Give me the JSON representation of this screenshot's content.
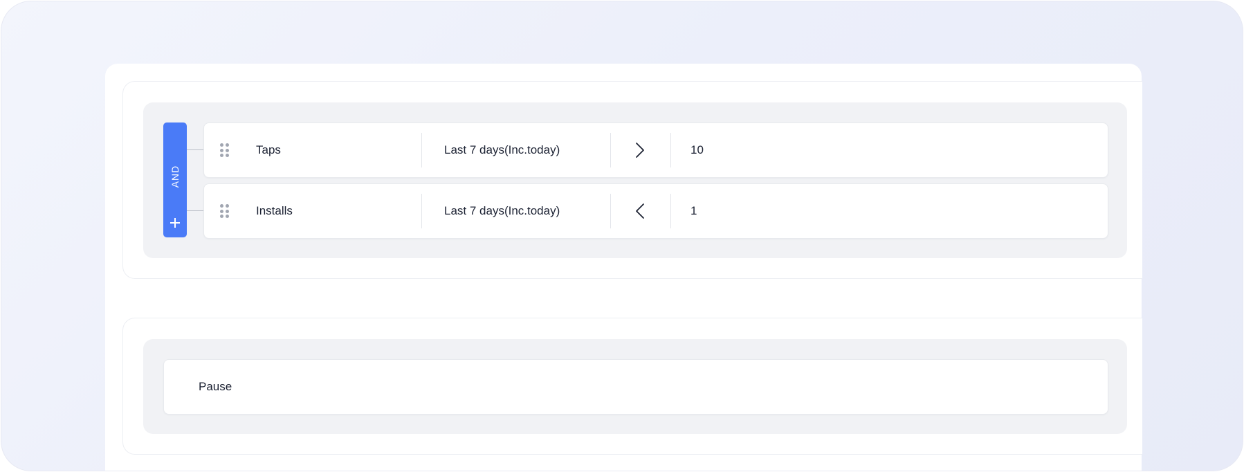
{
  "rule_group": {
    "operator_label": "AND",
    "add_icon": "plus-icon",
    "drag_icon": "drag-handle-icon",
    "conditions": [
      {
        "metric": "Taps",
        "period": "Last 7 days(Inc.today)",
        "comparator_icon": "greater-than-icon",
        "value": "10"
      },
      {
        "metric": "Installs",
        "period": "Last 7 days(Inc.today)",
        "comparator_icon": "less-than-icon",
        "value": "1"
      }
    ]
  },
  "action": {
    "label": "Pause"
  },
  "colors": {
    "accent": "#4a7bf7",
    "text": "#1c2233",
    "well": "#f1f2f5",
    "drag_handle": "#a1a6b1"
  }
}
